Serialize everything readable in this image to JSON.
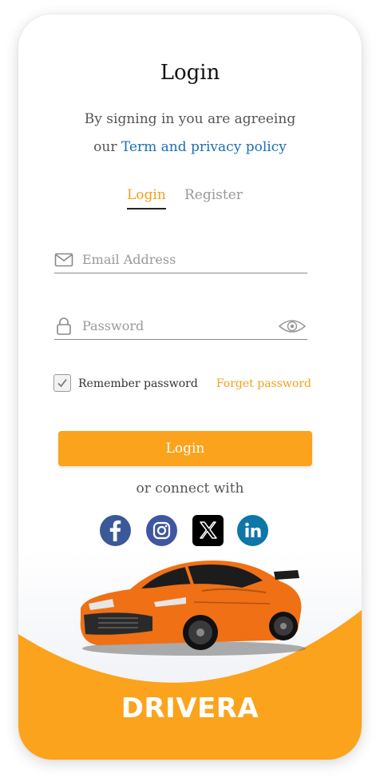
{
  "header": {
    "title": "Login",
    "subtitle_line1": "By signing in you are agreeing",
    "subtitle_prefix": "our",
    "policy_link": "Term and privacy policy"
  },
  "tabs": [
    {
      "label": "Login",
      "active": true
    },
    {
      "label": "Register",
      "active": false
    }
  ],
  "form": {
    "email": {
      "value": "",
      "placeholder": "Email Address",
      "icon": "mail-icon"
    },
    "password": {
      "value": "",
      "placeholder": "Password",
      "icon": "lock-icon",
      "toggle_icon": "eye-icon"
    },
    "remember_label": "Remember password",
    "remember_checked": true,
    "forget_label": "Forget password",
    "submit_label": "Login"
  },
  "connect_text": "or connect with",
  "social": [
    {
      "name": "facebook",
      "icon": "facebook-icon",
      "color": "#3b5998"
    },
    {
      "name": "instagram",
      "icon": "instagram-icon",
      "color": "#3f57a3"
    },
    {
      "name": "x",
      "icon": "x-icon",
      "color": "#000000"
    },
    {
      "name": "linkedin",
      "icon": "linkedin-icon",
      "color": "#0e76a8"
    }
  ],
  "brand": "DRIVERA",
  "colors": {
    "accent": "#fba31c",
    "link": "#1a6fb5"
  }
}
